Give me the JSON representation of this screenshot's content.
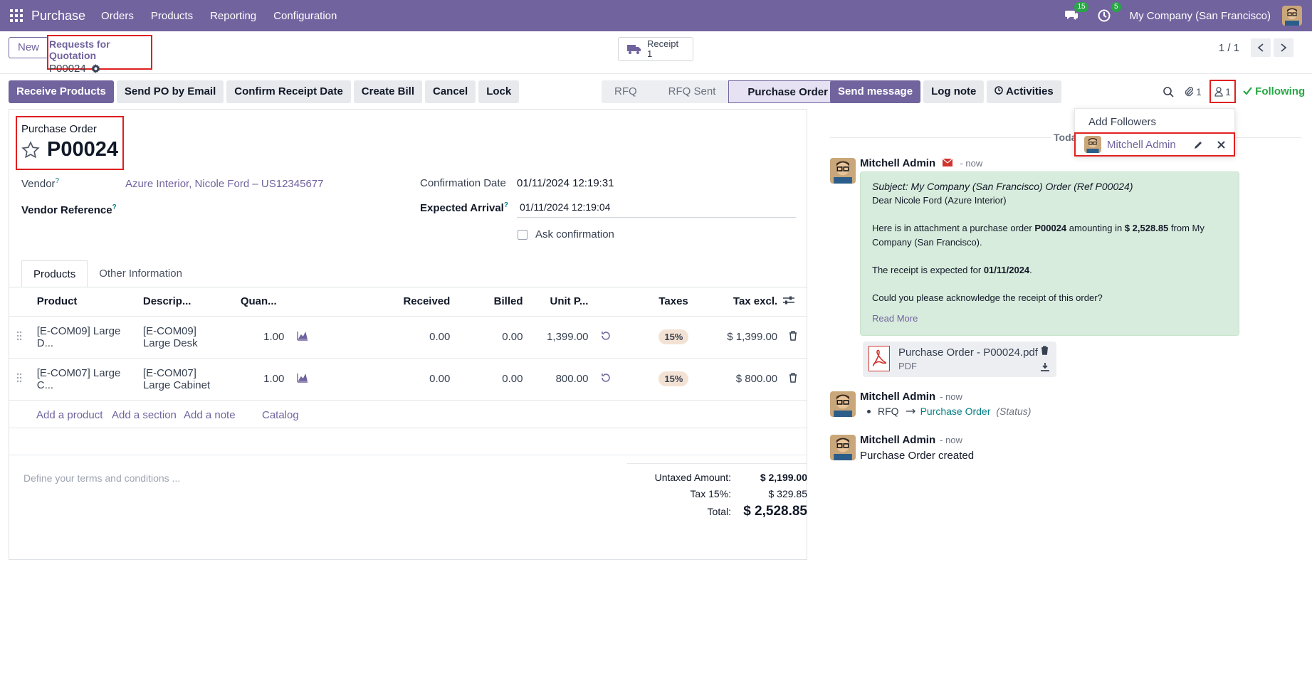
{
  "navbar": {
    "app_name": "Purchase",
    "menu": [
      "Orders",
      "Products",
      "Reporting",
      "Configuration"
    ],
    "messages_badge": "15",
    "activities_badge": "5",
    "company": "My Company (San Francisco)",
    "bg_color": "#71639e"
  },
  "control": {
    "new_label": "New",
    "breadcrumb_parent": "Requests for Quotation",
    "breadcrumb_current": "P00024",
    "receipt_label": "Receipt",
    "receipt_count": "1",
    "pager": "1 / 1"
  },
  "actions": {
    "receive": "Receive Products",
    "send_po": "Send PO by Email",
    "confirm_receipt": "Confirm Receipt Date",
    "create_bill": "Create Bill",
    "cancel": "Cancel",
    "lock": "Lock"
  },
  "stages": {
    "rfq": "RFQ",
    "rfq_sent": "RFQ Sent",
    "purchase_order": "Purchase Order"
  },
  "form": {
    "title_label": "Purchase Order",
    "name": "P00024",
    "vendor_label": "Vendor",
    "vendor_value": "Azure Interior, Nicole Ford – US12345677",
    "vendor_ref_label": "Vendor Reference",
    "confirmation_label": "Confirmation Date",
    "confirmation_value": "01/11/2024 12:19:31",
    "expected_label": "Expected Arrival",
    "expected_value": "01/11/2024 12:19:04",
    "ask_confirmation": "Ask confirmation",
    "help_mark": "?"
  },
  "tabs": [
    "Products",
    "Other Information"
  ],
  "lines": {
    "headers": [
      "Product",
      "Descrip...",
      "Quan...",
      "Received",
      "Billed",
      "Unit P...",
      "Taxes",
      "Tax excl."
    ],
    "rows": [
      {
        "product": "[E-COM09] Large D...",
        "desc1": "[E-COM09]",
        "desc2": "Large Desk",
        "qty": "1.00",
        "received": "0.00",
        "billed": "0.00",
        "unit": "1,399.00",
        "tax": "15%",
        "subtotal": "$ 1,399.00"
      },
      {
        "product": "[E-COM07] Large C...",
        "desc1": "[E-COM07]",
        "desc2": "Large Cabinet",
        "qty": "1.00",
        "received": "0.00",
        "billed": "0.00",
        "unit": "800.00",
        "tax": "15%",
        "subtotal": "$ 800.00"
      }
    ],
    "add_product": "Add a product",
    "add_section": "Add a section",
    "add_note": "Add a note",
    "catalog": "Catalog"
  },
  "terms_placeholder": "Define your terms and conditions ...",
  "totals": {
    "untaxed_label": "Untaxed Amount:",
    "untaxed_value": "$ 2,199.00",
    "tax_label": "Tax 15%:",
    "tax_value": "$ 329.85",
    "total_label": "Total:",
    "total_value": "$ 2,528.85"
  },
  "chatter": {
    "send_message": "Send message",
    "log_note": "Log note",
    "activities": "Activities",
    "attachments_count": "1",
    "followers_count": "1",
    "following": "Following",
    "add_followers": "Add Followers",
    "follower_name": "Mitchell Admin",
    "today": "Today",
    "messages": [
      {
        "author": "Mitchell Admin",
        "time": "- now"
      },
      {
        "author": "Mitchell Admin",
        "time": "- now"
      },
      {
        "author": "Mitchell Admin",
        "time": "- now"
      }
    ],
    "email": {
      "subject": "Subject: My Company (San Francisco) Order (Ref P00024)",
      "greeting": "Dear Nicole Ford (Azure Interior)",
      "line1_a": "Here is in attachment a purchase order ",
      "line1_ref": "P00024",
      "line1_b": " amounting in ",
      "line1_amount": "$ 2,528.85",
      "line1_c": " from My Company (San Francisco).",
      "line2_a": "The receipt is expected for ",
      "line2_date": "01/11/2024",
      "line2_b": ".",
      "line3": "Could you please acknowledge the receipt of this order?",
      "read_more": "Read More"
    },
    "attachment_name": "Purchase Order - P00024.pdf",
    "attachment_type": "PDF",
    "tracking_from": "RFQ",
    "tracking_to": "Purchase Order",
    "tracking_field": "(Status)",
    "created": "Purchase Order created"
  }
}
